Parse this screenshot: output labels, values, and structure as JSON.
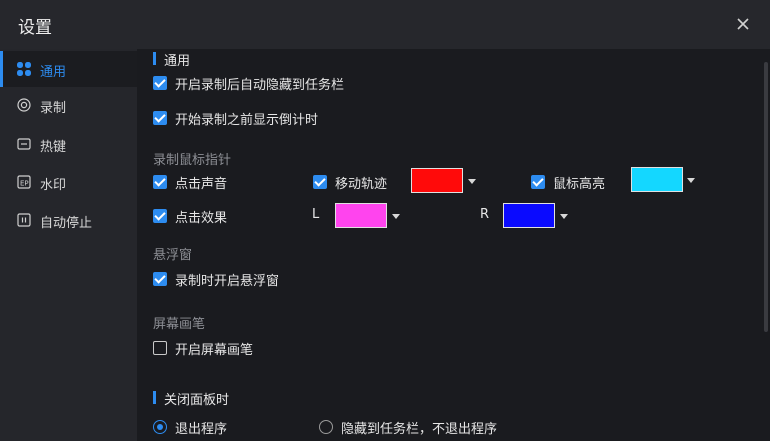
{
  "window": {
    "title": "设置"
  },
  "sidebar": {
    "items": [
      {
        "label": "通用",
        "icon": "grid-icon",
        "active": true
      },
      {
        "label": "录制",
        "icon": "record-icon",
        "active": false
      },
      {
        "label": "热键",
        "icon": "hotkey-icon",
        "active": false
      },
      {
        "label": "水印",
        "icon": "watermark-icon",
        "active": false
      },
      {
        "label": "自动停止",
        "icon": "auto-stop-icon",
        "active": false
      }
    ]
  },
  "general": {
    "title": "通用",
    "options": [
      {
        "label": "开启录制后自动隐藏到任务栏",
        "checked": true
      },
      {
        "label": "开始录制之前显示倒计时",
        "checked": true
      }
    ]
  },
  "cursor": {
    "title": "录制鼠标指针",
    "click_sound": {
      "label": "点击声音",
      "checked": true
    },
    "move_track": {
      "label": "移动轨迹",
      "checked": true,
      "color": "#ff0a0a"
    },
    "highlight": {
      "label": "鼠标高亮",
      "checked": true,
      "color": "#14d7ff"
    },
    "click_effect": {
      "label": "点击效果",
      "checked": true
    },
    "left": {
      "label": "L",
      "color": "#ff44ee"
    },
    "right": {
      "label": "R",
      "color": "#0a0aff"
    }
  },
  "floating": {
    "title": "悬浮窗",
    "option": {
      "label": "录制时开启悬浮窗",
      "checked": true
    }
  },
  "pen": {
    "title": "屏幕画笔",
    "option": {
      "label": "开启屏幕画笔",
      "checked": false
    }
  },
  "close_panel": {
    "title": "关闭面板时",
    "options": [
      {
        "label": "退出程序",
        "selected": true
      },
      {
        "label": "隐藏到任务栏，不退出程序",
        "selected": false
      }
    ]
  },
  "colors": {
    "accent": "#2d8cf0",
    "background": "#1a1b1f",
    "sidebar": "#25262b"
  }
}
